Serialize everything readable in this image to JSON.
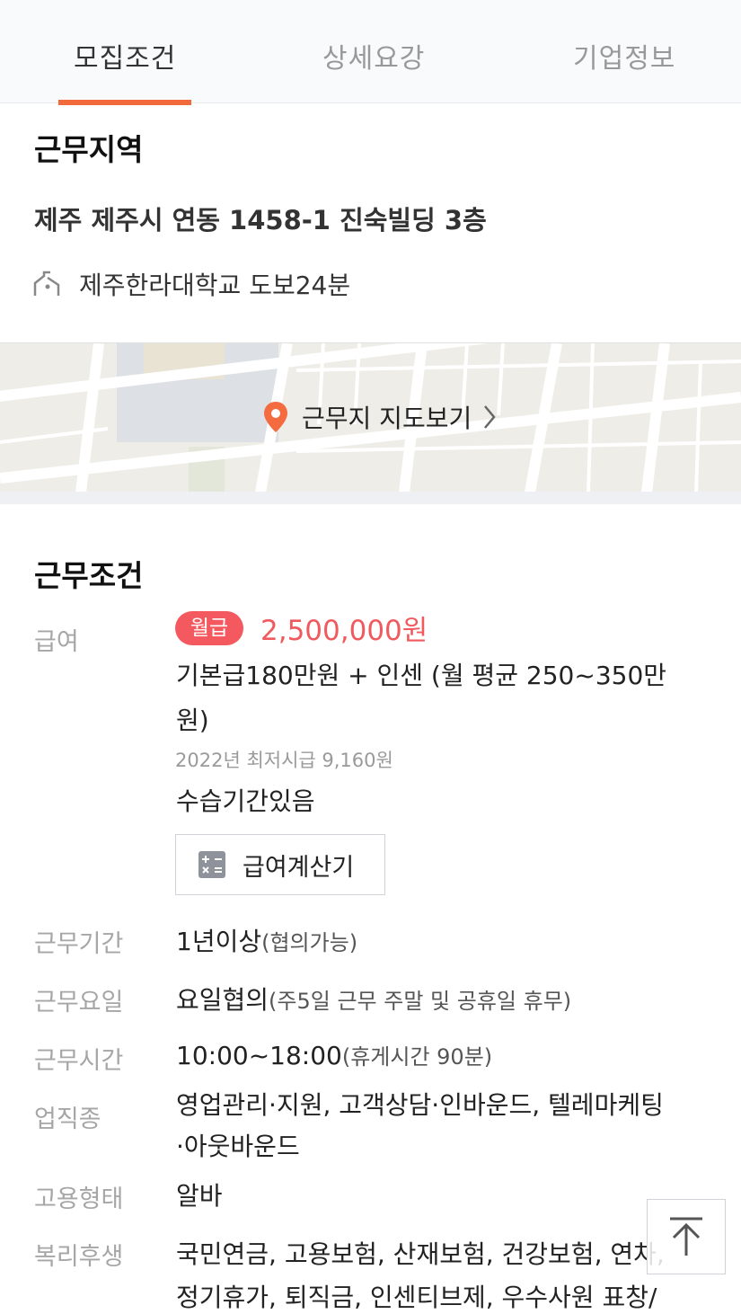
{
  "tabs": [
    "모집조건",
    "상세요강",
    "기업정보"
  ],
  "location": {
    "heading": "근무지역",
    "address": "제주 제주시 연동 1458-1 진숙빌딩 3층",
    "nearby": "제주한라대학교 도보24분",
    "map_link": "근무지 지도보기"
  },
  "conditions": {
    "heading": "근무조건",
    "salary": {
      "label": "급여",
      "badge": "월급",
      "amount": "2,500,000원",
      "desc_line1": "기본급180만원 + 인센 (월 평균 250~350만",
      "desc_line2": "원)",
      "min_wage_note": "2022년 최저시급 9,160원",
      "probation": "수습기간있음",
      "calc_button": "급여계산기"
    },
    "period": {
      "label": "근무기간",
      "value": "1년이상",
      "sub": "(협의가능)"
    },
    "days": {
      "label": "근무요일",
      "value": "요일협의",
      "sub": "(주5일 근무 주말 및 공휴일 휴무)"
    },
    "hours": {
      "label": "근무시간",
      "value": "10:00~18:00",
      "sub": "(휴게시간 90분)"
    },
    "job_type": {
      "label": "업직종",
      "line1": "영업관리·지원, 고객상담·인바운드, 텔레마케팅",
      "line2": "·아웃바운드"
    },
    "employment": {
      "label": "고용형태",
      "value": "알바"
    },
    "benefits": {
      "label": "복리후생",
      "line1": "국민연금, 고용보험, 산재보험, 건강보험, 연차,",
      "line2": "정기휴가, 퇴직금, 인센티브제, 우수사원 표창/"
    }
  },
  "icons": {
    "station": "walk-station-icon",
    "pin": "map-pin-icon",
    "calculator": "calculator-icon",
    "top": "arrow-up-icon"
  },
  "colors": {
    "accent": "#f26a3c",
    "badge": "#f4595f",
    "wage": "#f05a5f",
    "pin": "#f36b3f"
  }
}
